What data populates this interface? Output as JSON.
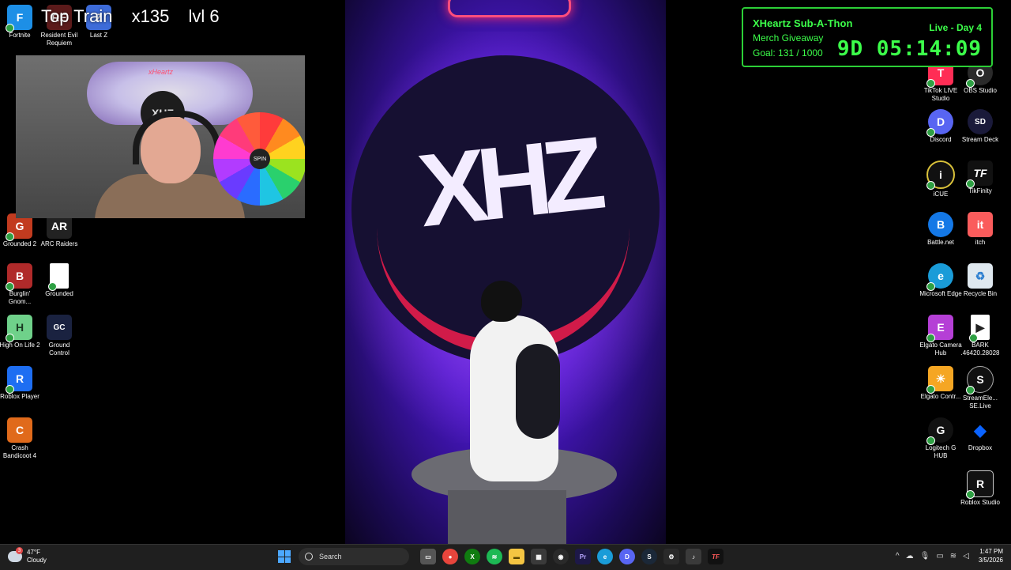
{
  "overlay": {
    "train_label": "Top Train",
    "train_count": "x135",
    "train_level": "lvl 6"
  },
  "left_icons": [
    {
      "label": "Fortnite",
      "color": "#1d8fe6",
      "glyph": "F"
    },
    {
      "label": "Resident Evil Requiem",
      "color": "#5b1a1a",
      "glyph": "RE"
    },
    {
      "label": "Last Z",
      "color": "#3d6bd8",
      "glyph": "Z"
    },
    {
      "label": "Grounded 2",
      "color": "#c23b1f",
      "glyph": "G"
    },
    {
      "label": "ARC Raiders",
      "color": "#222222",
      "glyph": "AR"
    },
    {
      "label": "Burglin' Gnom...",
      "color": "#b02a2a",
      "glyph": "B"
    },
    {
      "label": "Grounded",
      "color": "#ffffff",
      "glyph": ""
    },
    {
      "label": "High On Life 2",
      "color": "#6fd18a",
      "glyph": "H"
    },
    {
      "label": "Ground Control",
      "color": "#1a2240",
      "glyph": "GC"
    },
    {
      "label": "Roblox Player",
      "color": "#1e6ef2",
      "glyph": "R"
    },
    {
      "label": "Crash Bandicoot 4",
      "color": "#e06a1b",
      "glyph": "C"
    }
  ],
  "right_icons": [
    {
      "label": "TikTok LIVE Studio",
      "color": "#ff2d55",
      "glyph": "T"
    },
    {
      "label": "OBS Studio",
      "color": "#2a2a2a",
      "glyph": "O"
    },
    {
      "label": "Discord",
      "color": "#5865f2",
      "glyph": "D"
    },
    {
      "label": "Stream Deck",
      "color": "#1a1a3a",
      "glyph": "SD"
    },
    {
      "label": "iCUE",
      "color": "#111111",
      "glyph": "i"
    },
    {
      "label": "TikFinity",
      "color": "#111111",
      "glyph": "TF"
    },
    {
      "label": "Battle.net",
      "color": "#1478e6",
      "glyph": "B"
    },
    {
      "label": "itch",
      "color": "#fa5c5c",
      "glyph": "it"
    },
    {
      "label": "Microsoft Edge",
      "color": "#1a9cd8",
      "glyph": "e"
    },
    {
      "label": "Recycle Bin",
      "color": "#dfe8ef",
      "glyph": "♻"
    },
    {
      "label": "Elgato Camera Hub",
      "color": "#b53fd6",
      "glyph": "E"
    },
    {
      "label": "BARK .46420.28028",
      "color": "#2a2a2a",
      "glyph": "▶"
    },
    {
      "label": "Elgato Contr...",
      "color": "#f5a623",
      "glyph": "☀"
    },
    {
      "label": "StreamEle... SE.Live",
      "color": "#111111",
      "glyph": "S"
    },
    {
      "label": "Logitech G HUB",
      "color": "#111111",
      "glyph": "G"
    },
    {
      "label": "Dropbox",
      "color": "#0a63ff",
      "glyph": "◆"
    },
    {
      "label": "Roblox Studio",
      "color": "#111111",
      "glyph": "R"
    }
  ],
  "webcam": {
    "tag": "xHeartz",
    "logo": "XHZ",
    "wheel_hub": "SPIN"
  },
  "stream": {
    "logo": "XHZ"
  },
  "subathon": {
    "title": "XHeartz Sub-A-Thon",
    "subtitle": "Merch Giveaway",
    "goal": "Goal: 131 / 1000",
    "status": "Live - Day 4",
    "timer": "9D 05:14:09"
  },
  "taskbar": {
    "weather_temp": "47°F",
    "weather_desc": "Cloudy",
    "weather_badge": "3",
    "search_placeholder": "Search",
    "apps": [
      {
        "name": "file-explorer",
        "color": "#555555",
        "glyph": "▭"
      },
      {
        "name": "chrome",
        "color": "#e8453c",
        "glyph": "●"
      },
      {
        "name": "xbox",
        "color": "#107c10",
        "glyph": "X"
      },
      {
        "name": "spotify",
        "color": "#1db954",
        "glyph": "≋"
      },
      {
        "name": "folder",
        "color": "#f4c542",
        "glyph": "▬"
      },
      {
        "name": "store",
        "color": "#3a3a3a",
        "glyph": "▦"
      },
      {
        "name": "obs",
        "color": "#2a2a2a",
        "glyph": "◉"
      },
      {
        "name": "premiere",
        "color": "#1d1848",
        "glyph": "Pr"
      },
      {
        "name": "edge",
        "color": "#1a9cd8",
        "glyph": "e"
      },
      {
        "name": "discord",
        "color": "#5865f2",
        "glyph": "D"
      },
      {
        "name": "steam",
        "color": "#1b2838",
        "glyph": "S"
      },
      {
        "name": "gear",
        "color": "#2a2a2a",
        "glyph": "⚙"
      },
      {
        "name": "tiktok",
        "color": "#111111",
        "glyph": "♪"
      },
      {
        "name": "tikfinity",
        "color": "#111111",
        "glyph": "TF"
      }
    ],
    "time": "1:47 PM",
    "date": "3/5/2026"
  }
}
